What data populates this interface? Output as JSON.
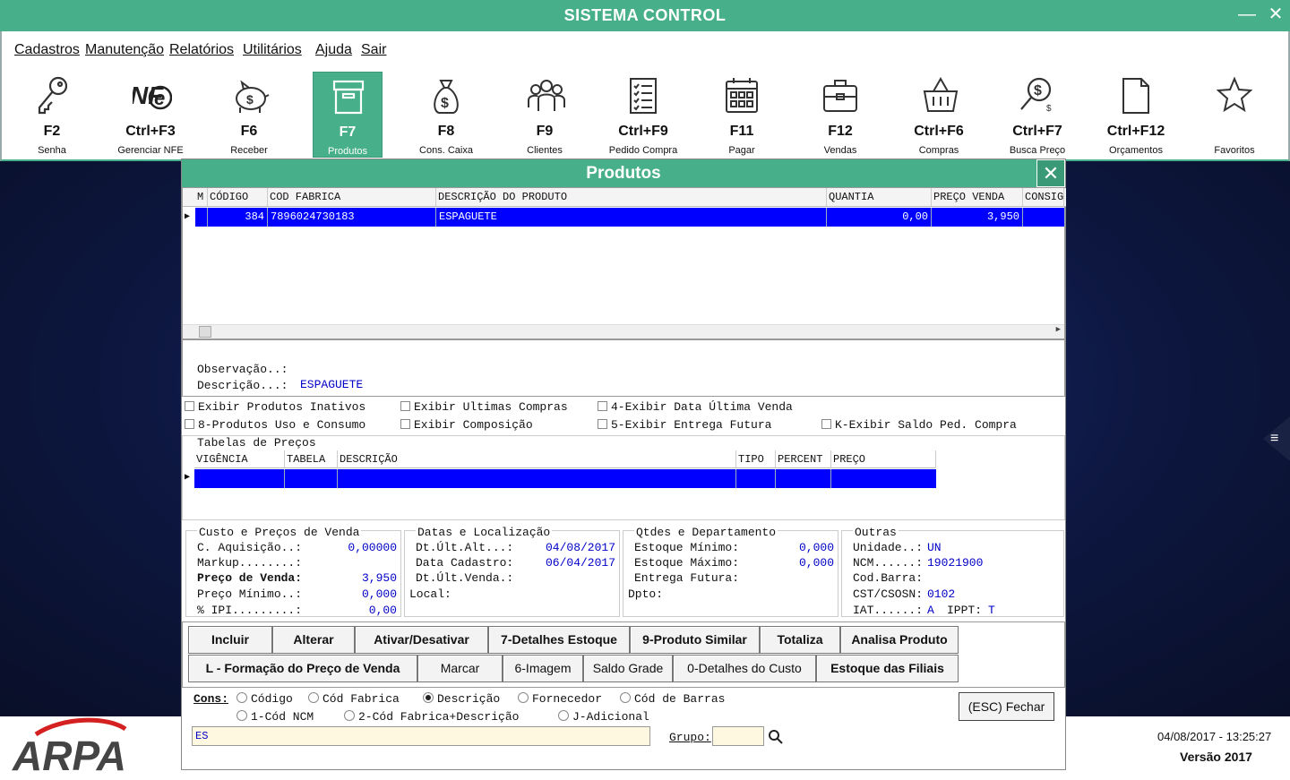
{
  "window": {
    "title": "SISTEMA CONTROL",
    "minimize": "—",
    "close": "✕"
  },
  "menu": [
    "Cadastros",
    "Manutenção",
    "Relatórios",
    "Utilitários",
    "Ajuda",
    "Sair"
  ],
  "toolbar": [
    {
      "key": "F2",
      "label": "Senha",
      "icon": "key-icon"
    },
    {
      "key": "Ctrl+F3",
      "label": "Gerenciar NFE",
      "icon": "nfe-icon"
    },
    {
      "key": "F6",
      "label": "Receber",
      "icon": "piggy-bank-icon"
    },
    {
      "key": "F7",
      "label": "Produtos",
      "icon": "box-icon",
      "active": true
    },
    {
      "key": "F8",
      "label": "Cons. Caixa",
      "icon": "money-bag-icon"
    },
    {
      "key": "F9",
      "label": "Clientes",
      "icon": "people-icon"
    },
    {
      "key": "Ctrl+F9",
      "label": "Pedido Compra",
      "icon": "checklist-icon"
    },
    {
      "key": "F11",
      "label": "Pagar",
      "icon": "calendar-icon"
    },
    {
      "key": "F12",
      "label": "Vendas",
      "icon": "briefcase-icon"
    },
    {
      "key": "Ctrl+F6",
      "label": "Compras",
      "icon": "basket-icon"
    },
    {
      "key": "Ctrl+F7",
      "label": "Busca Preço",
      "icon": "price-search-icon"
    },
    {
      "key": "Ctrl+F12",
      "label": "Orçamentos",
      "icon": "document-icon"
    },
    {
      "key": "",
      "label": "Favoritos",
      "icon": "star-icon"
    }
  ],
  "dialog": {
    "title": "Produtos",
    "close": "✕",
    "grid": {
      "headers": [
        "M",
        "CÓDIGO",
        "COD FABRICA",
        "DESCRIÇÃO DO PRODUTO",
        "QUANTIA",
        "PREÇO VENDA",
        "CONSIG"
      ],
      "rows": [
        {
          "m": "",
          "codigo": "384",
          "cod_fabrica": "7896024730183",
          "descricao": "ESPAGUETE",
          "quantia": "0,00",
          "preco": "3,950",
          "consig": ""
        }
      ]
    },
    "obs_label": "Observação..:",
    "desc_label": "Descrição...:",
    "desc_value": "ESPAGUETE",
    "checks": [
      "Exibir Produtos Inativos",
      "Exibir Ultimas Compras",
      "4-Exibir Data Última Venda",
      "8-Produtos Uso e Consumo",
      "Exibir Composição",
      "5-Exibir Entrega Futura",
      "K-Exibir Saldo Ped. Compra"
    ],
    "price_tables": {
      "title": "Tabelas de Preços",
      "headers": [
        "VIGÊNCIA",
        "TABELA",
        "DESCRIÇÃO",
        "TIPO",
        "PERCENT",
        "PREÇO"
      ]
    },
    "custo": {
      "title": "Custo e Preços de Venda",
      "rows": [
        [
          "C. Aquisição..:",
          "0,00000"
        ],
        [
          "Markup........:",
          ""
        ],
        [
          "Preço de Venda:",
          "3,950"
        ],
        [
          "Preço Mínimo..:",
          "0,000"
        ],
        [
          "% IPI.........:",
          "0,00"
        ]
      ]
    },
    "datas": {
      "title": "Datas e Localização",
      "rows": [
        [
          "Dt.Últ.Alt...:",
          "04/08/2017"
        ],
        [
          "Data Cadastro:",
          "06/04/2017"
        ],
        [
          "Dt.Últ.Venda.:",
          ""
        ],
        [
          "Local:",
          ""
        ]
      ]
    },
    "qtdes": {
      "title": "Qtdes e Departamento",
      "rows": [
        [
          "Estoque Mínimo:",
          "0,000"
        ],
        [
          "Estoque Máximo:",
          "0,000"
        ],
        [
          "Entrega Futura:",
          ""
        ],
        [
          "Dpto:",
          ""
        ]
      ]
    },
    "outras": {
      "title": "Outras",
      "rows": [
        [
          "Unidade..:",
          "UN"
        ],
        [
          "NCM......:",
          "19021900"
        ],
        [
          "Cod.Barra:",
          ""
        ],
        [
          "CST/CSOSN:",
          "0102"
        ],
        [
          "IAT......:",
          "A"
        ]
      ],
      "ippt_label": "IPPT:",
      "ippt_value": "T"
    },
    "buttons1": [
      "Incluir",
      "Alterar",
      "Ativar/Desativar",
      "7-Detalhes Estoque",
      "9-Produto Similar",
      "Totaliza",
      "Analisa Produto"
    ],
    "buttons2": [
      "L - Formação do Preço de Venda",
      "Marcar",
      "6-Imagem",
      "Saldo Grade",
      "0-Detalhes do Custo",
      "Estoque das Filiais"
    ],
    "cons_label": "Cons:",
    "radios": [
      "Código",
      "Cód Fabrica",
      "Descrição",
      "Fornecedor",
      "Cód de Barras",
      "1-Cód NCM",
      "2-Cód Fabrica+Descrição",
      "J-Adicional"
    ],
    "selected_radio": "Descrição",
    "search_value": "ES",
    "grupo_label": "Grupo:",
    "grupo_value": "",
    "fechar": "(ESC) Fechar"
  },
  "footer": {
    "logo": "ARPA",
    "datetime": "04/08/2017 - 13:25:27",
    "version": "Versão 2017"
  }
}
